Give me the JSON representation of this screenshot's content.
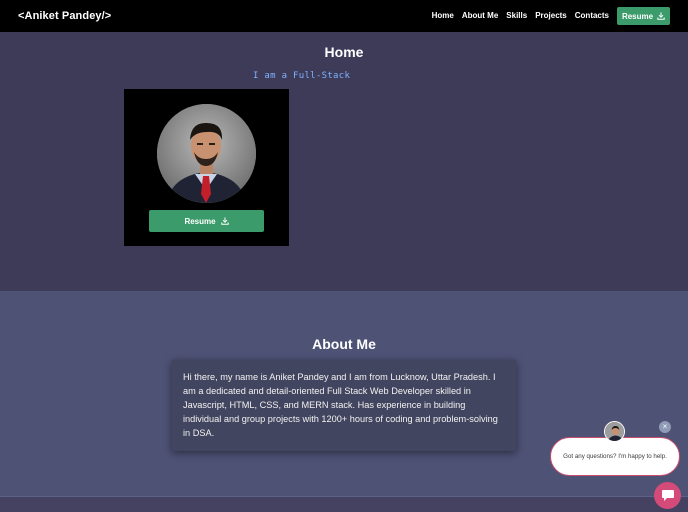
{
  "navbar": {
    "brand": "<Aniket Pandey/>",
    "links": [
      "Home",
      "About Me",
      "Skills",
      "Projects",
      "Contacts"
    ],
    "resume_label": "Resume"
  },
  "home": {
    "title": "Home",
    "typing_text": "I am a Full-Stack",
    "resume_label": "Resume"
  },
  "about": {
    "title": "About Me",
    "text": "Hi there, my name is Aniket Pandey and I am from Lucknow, Uttar Pradesh. I am a dedicated and detail-oriented Full Stack Web Developer skilled in Javascript, HTML, CSS, and MERN stack. Has experience in building individual and group projects with 1200+ hours of coding and problem-solving in DSA."
  },
  "chat": {
    "message": "Got any questions? I'm happy to help.",
    "close_glyph": "×"
  },
  "colors": {
    "accent_green": "#3b9b6a",
    "typing_blue": "#7fb2ff",
    "chat_pink": "#d44a79"
  }
}
